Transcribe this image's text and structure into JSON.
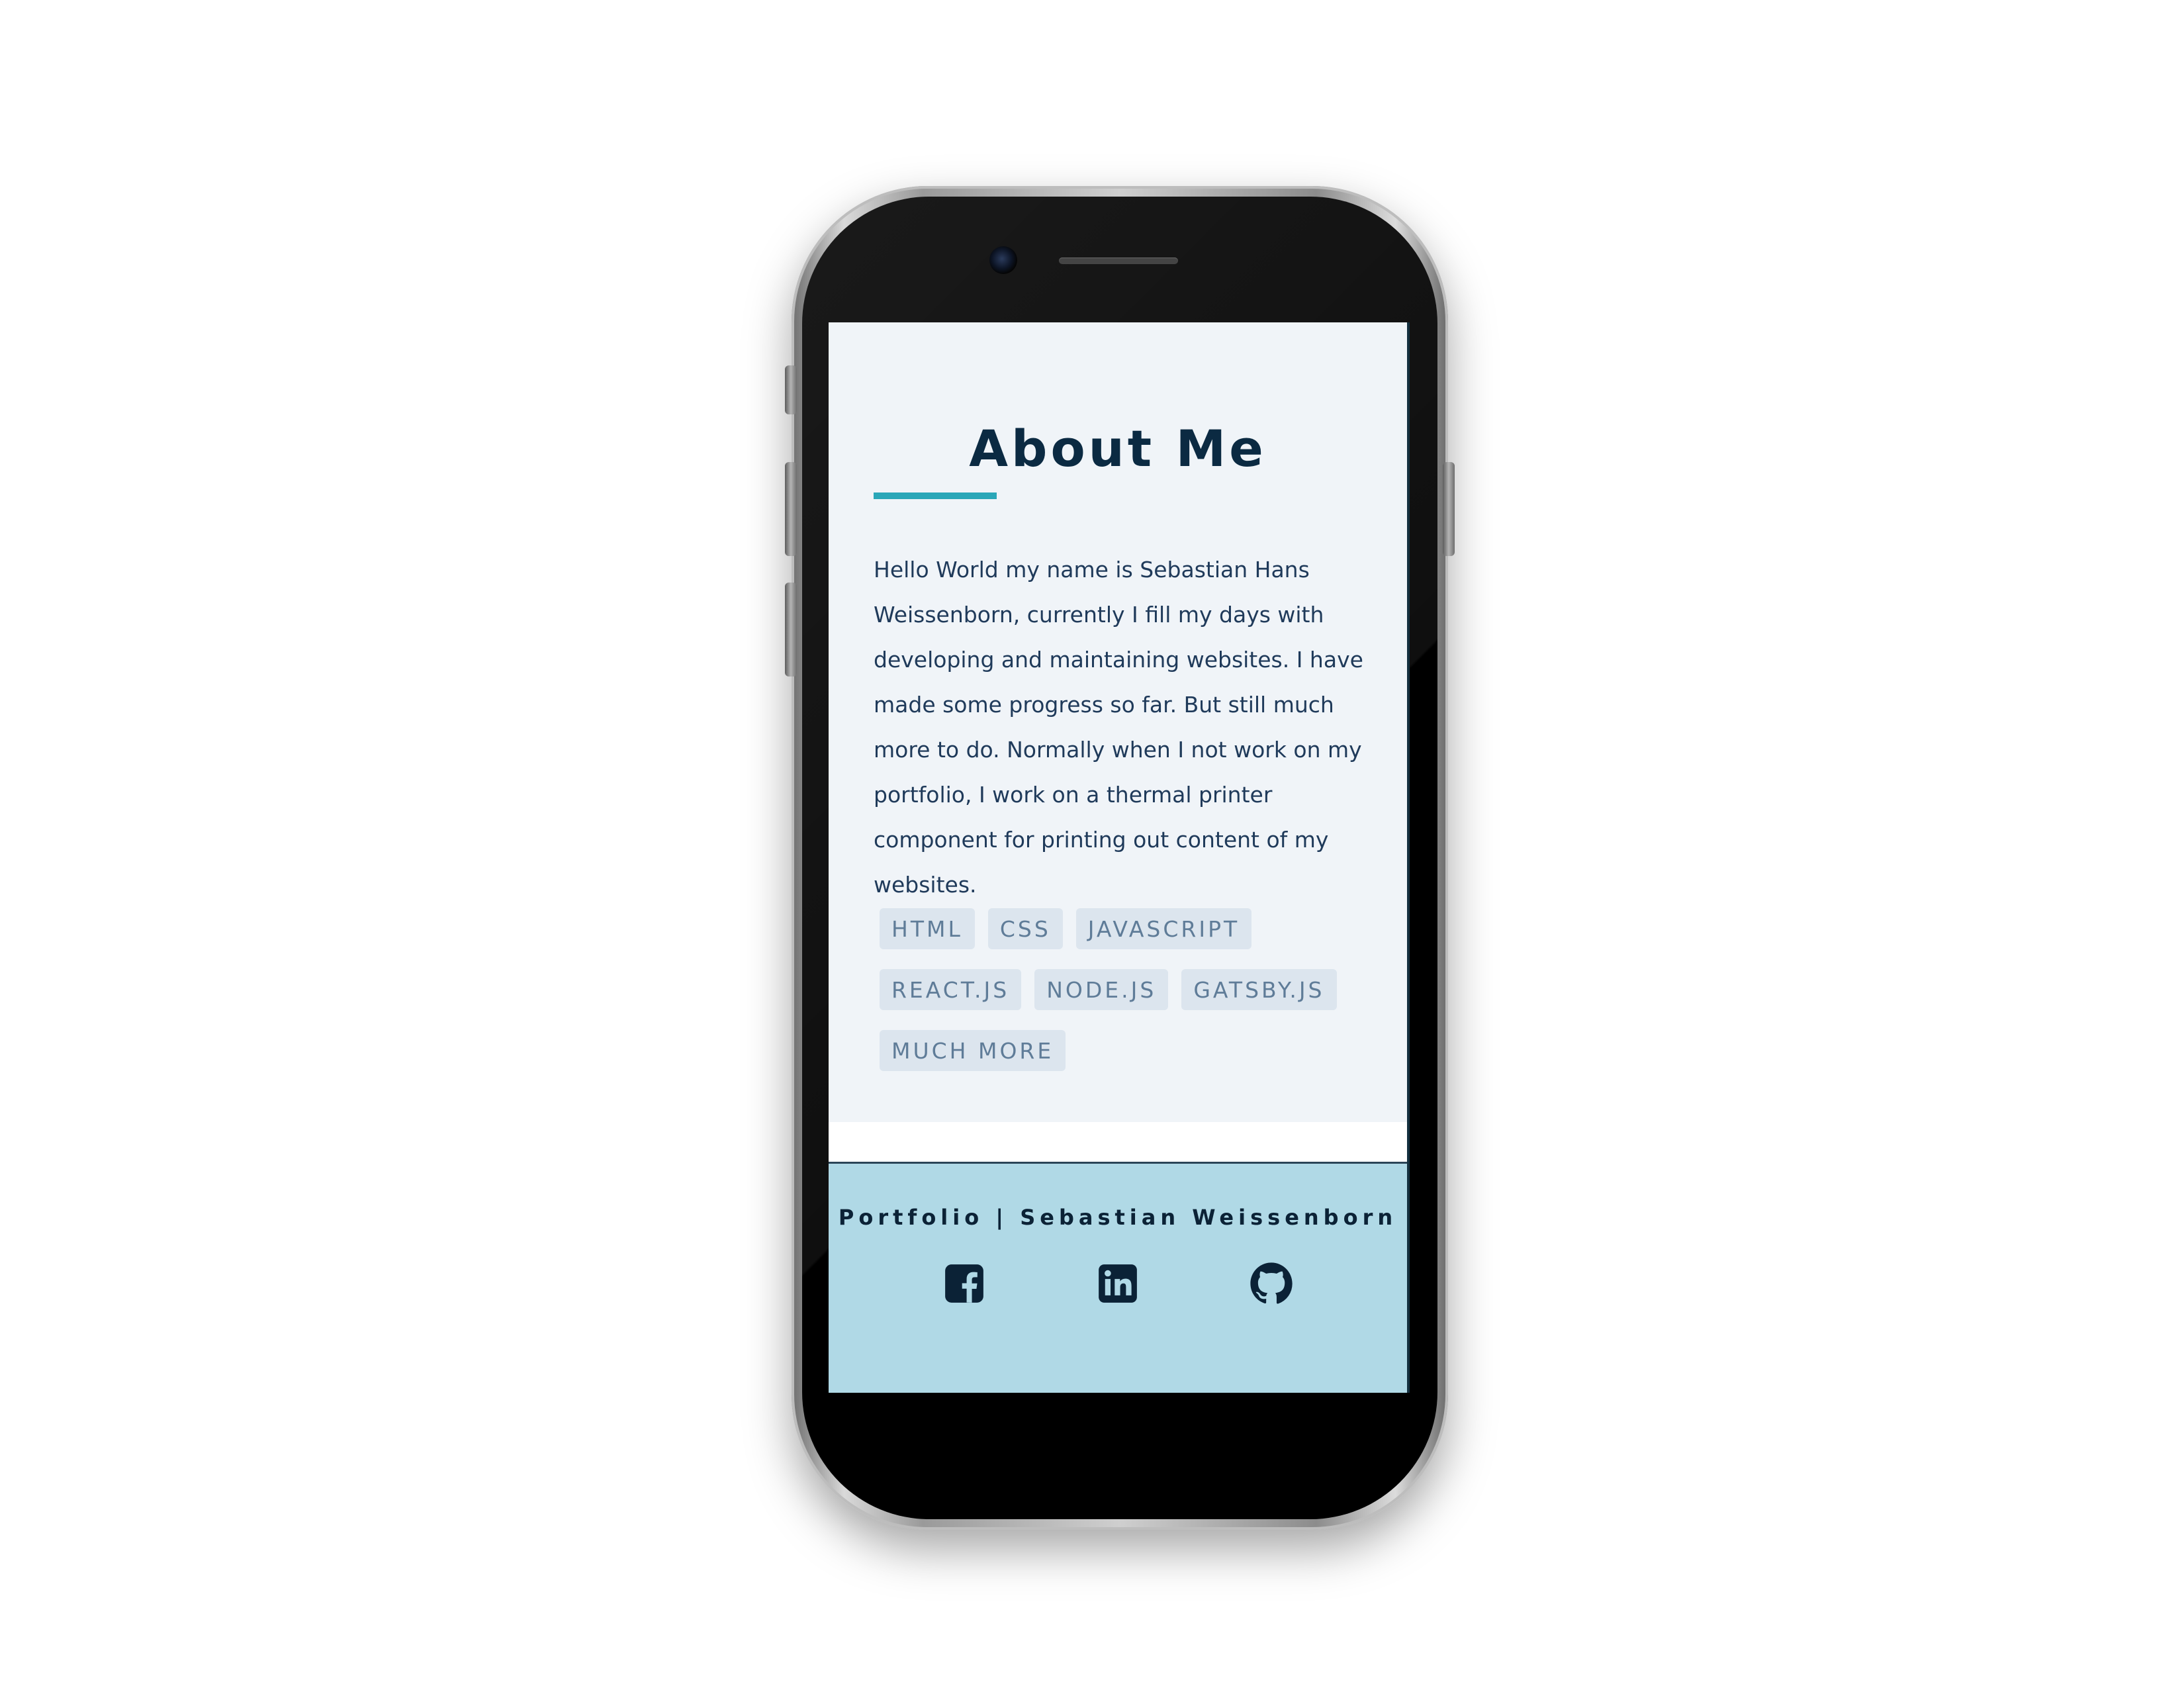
{
  "about": {
    "title": "About Me",
    "paragraph": "Hello World my name is Sebastian Hans Weissenborn, currently I fill my days with developing and maintaining websites. I have made some progress so far. But still much more to do. Normally when I not work on my portfolio, I work on a thermal printer component for printing out content of my websites.",
    "tags": [
      "HTML",
      "CSS",
      "JAVASCRIPT",
      "REACT.JS",
      "NODE.JS",
      "GATSBY.JS",
      "MUCH MORE"
    ]
  },
  "footer": {
    "title": "Portfolio | Sebastian Weissenborn",
    "social": [
      {
        "icon": "facebook-icon"
      },
      {
        "icon": "linkedin-icon"
      },
      {
        "icon": "github-icon"
      }
    ]
  },
  "colors": {
    "background": "#f0f4f8",
    "heading": "#0b2a42",
    "accent": "#2aa7b8",
    "text": "#1f3a5a",
    "tag_bg": "#dce5ee",
    "tag_text": "#5f7c98",
    "footer_bg": "#b0d9e6"
  }
}
